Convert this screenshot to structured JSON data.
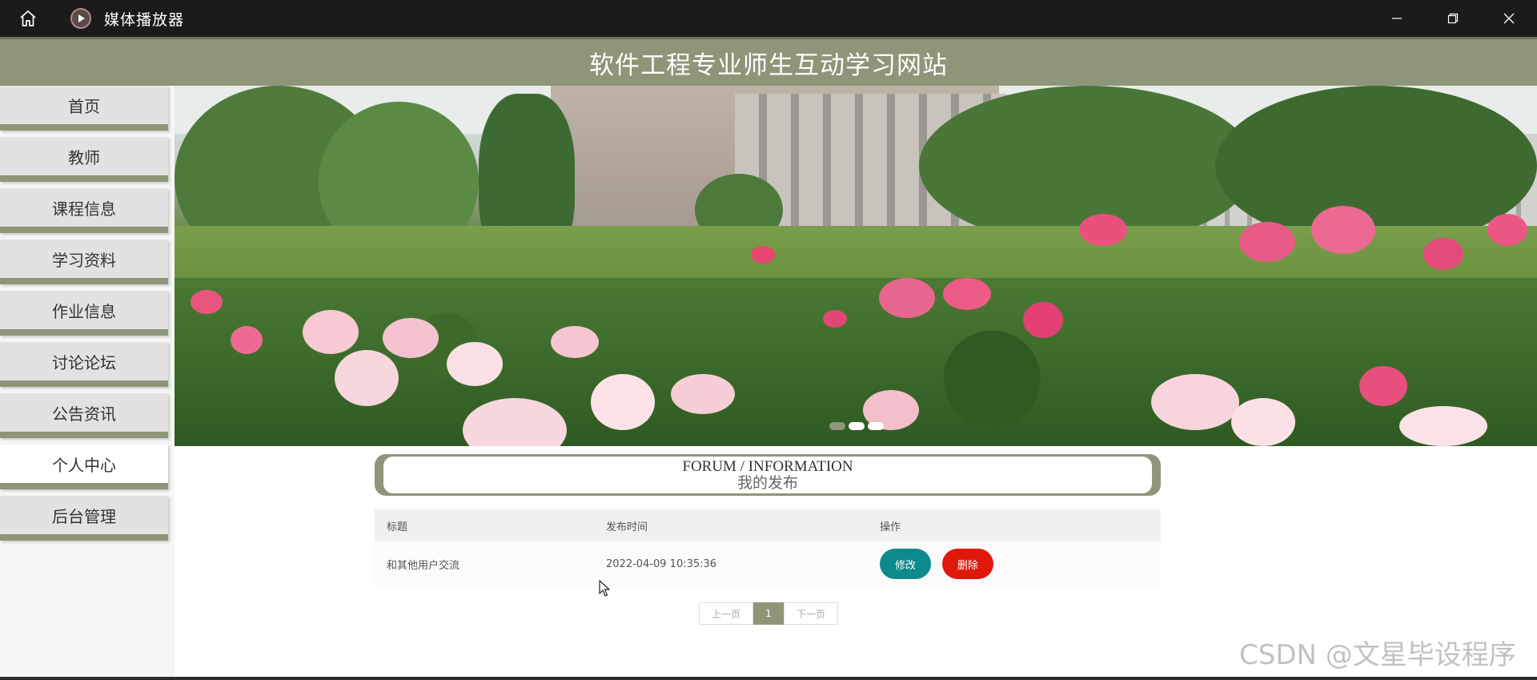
{
  "window": {
    "app_title": "媒体播放器",
    "icons": [
      "home-icon",
      "play-icon",
      "minimize-icon",
      "restore-icon",
      "close-icon"
    ]
  },
  "site": {
    "title": "软件工程专业师生互动学习网站"
  },
  "sidebar": {
    "items": [
      {
        "label": "首页"
      },
      {
        "label": "教师"
      },
      {
        "label": "课程信息"
      },
      {
        "label": "学习资料"
      },
      {
        "label": "作业信息"
      },
      {
        "label": "讨论论坛"
      },
      {
        "label": "公告资讯"
      },
      {
        "label": "个人中心",
        "active": true
      },
      {
        "label": "后台管理"
      }
    ]
  },
  "banner": {
    "slides": 3,
    "active_slide": 1
  },
  "forum": {
    "title": "FORUM / INFORMATION",
    "subtitle": "我的发布"
  },
  "table": {
    "headers": [
      "标题",
      "发布时间",
      "操作"
    ],
    "rows": [
      {
        "title": "和其他用户交流",
        "time": "2022-04-09 10:35:36",
        "edit": "修改",
        "delete": "删除"
      }
    ]
  },
  "pagination": {
    "prev": "上一页",
    "current": "1",
    "next": "下一页"
  },
  "watermark": "CSDN @文星毕设程序",
  "colors": {
    "accent": "#8f9578",
    "edit": "#0d8a8b",
    "delete": "#e0180c",
    "titlebar": "#1b1b1b"
  }
}
